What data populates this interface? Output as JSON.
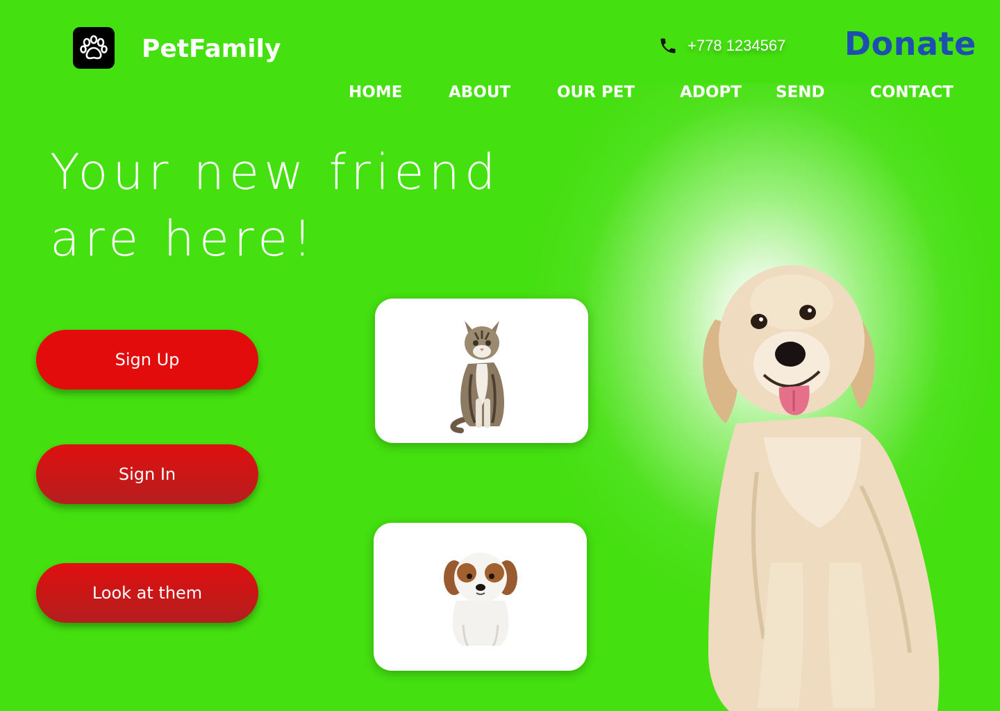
{
  "header": {
    "brand": "PetFamily",
    "phone": "+778 1234567",
    "donate": "Donate"
  },
  "nav": [
    "HOME",
    "ABOUT",
    "OUR PET",
    "ADOPT",
    "SEND",
    "CONTACT"
  ],
  "hero": {
    "line1": "Your new friend",
    "line2": "are here!"
  },
  "buttons": {
    "sign_up": "Sign Up",
    "sign_in": "Sign In",
    "look": "Look at them"
  },
  "colors": {
    "background": "#44e010",
    "button_red": "#e20c0c",
    "donate_blue": "#1c4fb0"
  },
  "icons": {
    "logo": "paw-icon",
    "phone": "phone-icon"
  }
}
